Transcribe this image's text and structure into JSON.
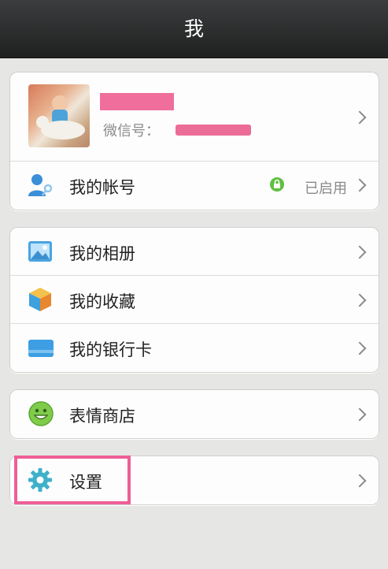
{
  "header": {
    "title": "我"
  },
  "profile": {
    "wechat_id_label": "微信号："
  },
  "account": {
    "label": "我的帐号",
    "status": "已启用"
  },
  "menu_group_1": [
    {
      "label": "我的相册",
      "icon": "photo-album-icon"
    },
    {
      "label": "我的收藏",
      "icon": "favorites-box-icon"
    },
    {
      "label": "我的银行卡",
      "icon": "bank-card-icon"
    }
  ],
  "sticker_shop": {
    "label": "表情商店",
    "icon": "smiley-icon"
  },
  "settings": {
    "label": "设置",
    "icon": "gear-icon"
  },
  "colors": {
    "highlight": "#ee5f96",
    "redaction": "#f06e9c",
    "status_green": "#5fbf3f"
  }
}
